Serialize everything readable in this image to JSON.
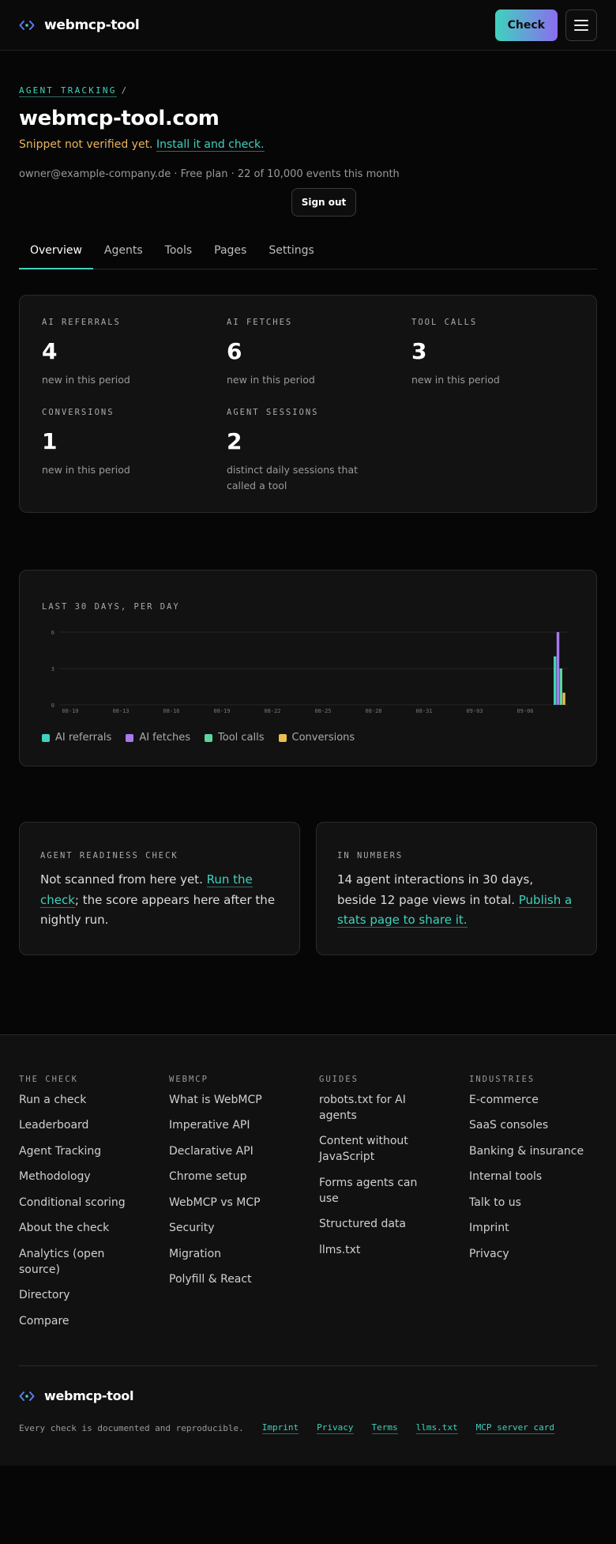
{
  "header": {
    "brand": "webmcp-tool",
    "check_label": "Check"
  },
  "breadcrumb": {
    "parent": "AGENT TRACKING",
    "separator": "/"
  },
  "site": {
    "title": "webmcp-tool.com",
    "warning_text": "Snippet not verified yet.",
    "warning_link": "Install it and check.",
    "meta": "owner@example-company.de · Free plan · 22 of 10,000 events this month",
    "signout_label": "Sign out"
  },
  "tabs": [
    "Overview",
    "Agents",
    "Tools",
    "Pages",
    "Settings"
  ],
  "stats": [
    {
      "label": "AI REFERRALS",
      "value": "4",
      "note": "new in this period"
    },
    {
      "label": "AI FETCHES",
      "value": "6",
      "note": "new in this period"
    },
    {
      "label": "TOOL CALLS",
      "value": "3",
      "note": "new in this period"
    },
    {
      "label": "CONVERSIONS",
      "value": "1",
      "note": "new in this period"
    },
    {
      "label": "AGENT SESSIONS",
      "value": "2",
      "note": "distinct daily sessions that called a tool"
    }
  ],
  "chart_data": {
    "type": "bar",
    "title": "LAST 30 DAYS, PER DAY",
    "x_tick_labels": [
      "08-10",
      "08-13",
      "08-16",
      "08-19",
      "08-22",
      "08-25",
      "08-28",
      "08-31",
      "09-03",
      "09-06"
    ],
    "y_ticks": [
      0,
      3,
      6
    ],
    "ylim": [
      0,
      6
    ],
    "grid": true,
    "legend": "bottom-left",
    "categories_note_last_day": "single day with activity at end of range",
    "series": [
      {
        "name": "AI referrals",
        "color": "#3fd2bd",
        "last_value": 4
      },
      {
        "name": "AI fetches",
        "color": "#a57af0",
        "last_value": 6
      },
      {
        "name": "Tool calls",
        "color": "#5cd69e",
        "last_value": 3
      },
      {
        "name": "Conversions",
        "color": "#e9bf4d",
        "last_value": 1
      }
    ]
  },
  "readiness": {
    "label": "AGENT READINESS CHECK",
    "text_before": "Not scanned from here yet.",
    "link": "Run the check",
    "text_after": "; the score appears here after the nightly run."
  },
  "numbers": {
    "label": "IN NUMBERS",
    "text_before": "14 agent interactions in 30 days, beside 12 page views in total.",
    "link": "Publish a stats page to share it."
  },
  "footer": {
    "columns": [
      {
        "heading": "THE CHECK",
        "links": [
          "Run a check",
          "Leaderboard",
          "Agent Tracking",
          "Methodology",
          "Conditional scoring",
          "About the check",
          "Analytics (open source)",
          "Directory",
          "Compare"
        ]
      },
      {
        "heading": "WEBMCP",
        "links": [
          "What is WebMCP",
          "Imperative API",
          "Declarative API",
          "Chrome setup",
          "WebMCP vs MCP",
          "Security",
          "Migration",
          "Polyfill & React"
        ]
      },
      {
        "heading": "GUIDES",
        "links": [
          "robots.txt for AI agents",
          "Content without JavaScript",
          "Forms agents can use",
          "Structured data",
          "llms.txt"
        ]
      },
      {
        "heading": "INDUSTRIES",
        "links": [
          "E-commerce",
          "SaaS consoles",
          "Banking & insurance",
          "Internal tools",
          "Talk to us",
          "Imprint",
          "Privacy"
        ]
      }
    ],
    "brand": "webmcp-tool",
    "tagline": "Every check is documented and reproducible.",
    "legal_links": [
      "Imprint",
      "Privacy",
      "Terms",
      "llms.txt",
      "MCP server card"
    ]
  }
}
